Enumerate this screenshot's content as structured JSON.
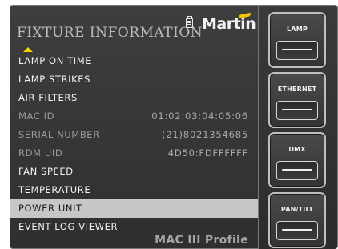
{
  "screen": {
    "title": "FIXTURE INFORMATION",
    "brand": "Martin",
    "model": "MAC III Profile",
    "menu": [
      {
        "label": "LAMP ON TIME",
        "value": "",
        "state": "normal"
      },
      {
        "label": "LAMP STRIKES",
        "value": "",
        "state": "normal"
      },
      {
        "label": "AIR FILTERS",
        "value": "",
        "state": "normal"
      },
      {
        "label": "MAC ID",
        "value": "01:02:03:04:05:06",
        "state": "dim"
      },
      {
        "label": "SERIAL NUMBER",
        "value": "(21)8021354685",
        "state": "dim"
      },
      {
        "label": "RDM UID",
        "value": "4D50:FDFFFFFF",
        "state": "dim"
      },
      {
        "label": "FAN SPEED",
        "value": "",
        "state": "normal"
      },
      {
        "label": "TEMPERATURE",
        "value": "",
        "state": "normal"
      },
      {
        "label": "POWER UNIT",
        "value": "",
        "state": "selected"
      },
      {
        "label": "EVENT LOG VIEWER",
        "value": "",
        "state": "normal"
      }
    ]
  },
  "buttons": [
    {
      "label": "LAMP"
    },
    {
      "label": "ETHERNET"
    },
    {
      "label": "DMX"
    },
    {
      "label": "PAN/TILT"
    }
  ],
  "icons": {
    "scroll_up": "up-arrow-icon",
    "document": "document-icon",
    "brand_mark": "brand-tick-icon"
  },
  "colors": {
    "selected_row_bg": "#c7c7c7",
    "scroll_arrow": "#f5d500",
    "brand_tick": "#f2c200"
  }
}
